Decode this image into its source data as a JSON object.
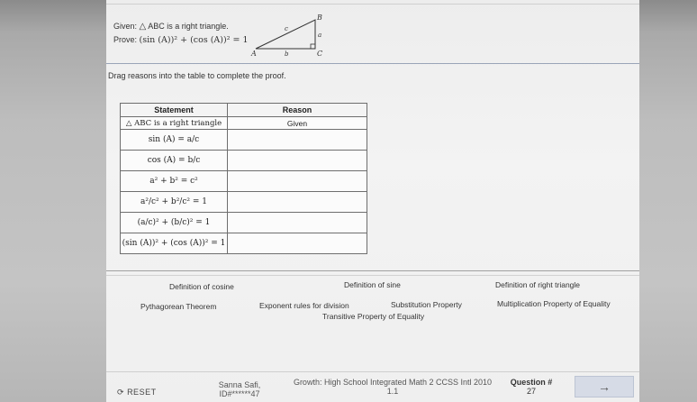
{
  "problem": {
    "given_label": "Given:",
    "given_text": "ABC is a right triangle.",
    "prove_label": "Prove:",
    "prove_text": "(sin (A))² + (cos (A))² = 1"
  },
  "diagram": {
    "vertex_a": "A",
    "vertex_b": "B",
    "vertex_c": "C",
    "side_a": "a",
    "side_b": "b",
    "side_c": "c"
  },
  "instructions": "Drag reasons into the table to complete the proof.",
  "table": {
    "headers": [
      "Statement",
      "Reason"
    ],
    "rows": [
      {
        "statement": "ABC is a right triangle",
        "reason": "Given"
      },
      {
        "statement": "sin (A) = a/c",
        "reason": ""
      },
      {
        "statement": "cos (A) = b/c",
        "reason": ""
      },
      {
        "statement": "a² + b² = c²",
        "reason": ""
      },
      {
        "statement": "a²/c² + b²/c² = 1",
        "reason": ""
      },
      {
        "statement": "(a/c)² + (b/c)² = 1",
        "reason": ""
      },
      {
        "statement": "(sin (A))² + (cos (A))² = 1",
        "reason": ""
      }
    ]
  },
  "reason_bank": [
    "Definition of cosine",
    "Definition of sine",
    "Definition of right triangle",
    "Pythagorean Theorem",
    "Exponent rules for division",
    "Substitution Property",
    "Multiplication Property of Equality",
    "Transitive Property of Equality"
  ],
  "footer": {
    "reset_label": "RESET",
    "student_name": "Sanna Safi,",
    "student_id": "ID#******47",
    "course": "Growth: High School Integrated Math 2 CCSS Intl 2010",
    "section": "1.1",
    "question_label": "Question #",
    "question_number": "27",
    "next_arrow": "→"
  },
  "colors": {
    "next_button_bg": "#d6dbe6",
    "table_border": "#6e6e6e",
    "separator": "#9aa5b8"
  }
}
